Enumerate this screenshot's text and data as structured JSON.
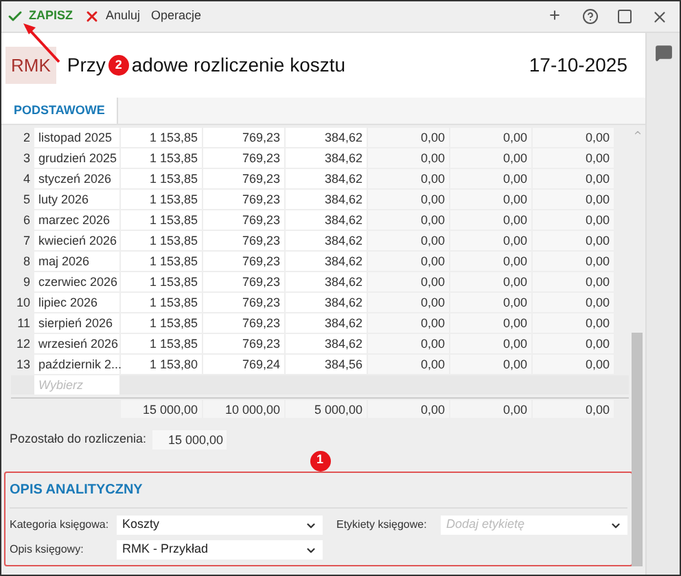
{
  "toolbar": {
    "buttons": [
      {
        "kind": "save",
        "label": "ZAPISZ"
      },
      {
        "kind": "cancel",
        "label": "Anuluj"
      },
      {
        "kind": "plain",
        "label": "Operacje"
      }
    ]
  },
  "header": {
    "badge": "RMK",
    "title_parts": [
      "Przy",
      "adowe rozliczenie kosztu"
    ],
    "marker": "2",
    "date": "17-10-2025"
  },
  "tabs": [
    {
      "label": "PODSTAWOWE",
      "selected": true
    }
  ],
  "table": {
    "rows": [
      {
        "number": "2",
        "month": "listopad 2025",
        "values": [
          "1 153,85",
          "769,23",
          "384,62",
          "0,00",
          "0,00",
          "0,00"
        ]
      },
      {
        "number": "3",
        "month": "grudzień 2025",
        "values": [
          "1 153,85",
          "769,23",
          "384,62",
          "0,00",
          "0,00",
          "0,00"
        ]
      },
      {
        "number": "4",
        "month": "styczeń 2026",
        "values": [
          "1 153,85",
          "769,23",
          "384,62",
          "0,00",
          "0,00",
          "0,00"
        ]
      },
      {
        "number": "5",
        "month": "luty 2026",
        "values": [
          "1 153,85",
          "769,23",
          "384,62",
          "0,00",
          "0,00",
          "0,00"
        ]
      },
      {
        "number": "6",
        "month": "marzec 2026",
        "values": [
          "1 153,85",
          "769,23",
          "384,62",
          "0,00",
          "0,00",
          "0,00"
        ]
      },
      {
        "number": "7",
        "month": "kwiecień 2026",
        "values": [
          "1 153,85",
          "769,23",
          "384,62",
          "0,00",
          "0,00",
          "0,00"
        ]
      },
      {
        "number": "8",
        "month": "maj 2026",
        "values": [
          "1 153,85",
          "769,23",
          "384,62",
          "0,00",
          "0,00",
          "0,00"
        ]
      },
      {
        "number": "9",
        "month": "czerwiec 2026",
        "values": [
          "1 153,85",
          "769,23",
          "384,62",
          "0,00",
          "0,00",
          "0,00"
        ]
      },
      {
        "number": "10",
        "month": "lipiec 2026",
        "values": [
          "1 153,85",
          "769,23",
          "384,62",
          "0,00",
          "0,00",
          "0,00"
        ]
      },
      {
        "number": "11",
        "month": "sierpień 2026",
        "values": [
          "1 153,85",
          "769,23",
          "384,62",
          "0,00",
          "0,00",
          "0,00"
        ]
      },
      {
        "number": "12",
        "month": "wrzesień 2026",
        "values": [
          "1 153,85",
          "769,23",
          "384,62",
          "0,00",
          "0,00",
          "0,00"
        ]
      },
      {
        "number": "13",
        "month": "październik 2...",
        "values": [
          "1 153,80",
          "769,24",
          "384,56",
          "0,00",
          "0,00",
          "0,00"
        ]
      }
    ],
    "new_row_placeholder": "Wybierz",
    "totals": [
      "15 000,00",
      "10 000,00",
      "5 000,00",
      "0,00",
      "0,00",
      "0,00"
    ]
  },
  "remaining": {
    "label": "Pozostało do rozliczenia:",
    "value": "15 000,00"
  },
  "marker": "1",
  "analytic_section": {
    "title": "OPIS ANALITYCZNY",
    "highlighted": true,
    "category": {
      "label": "Kategoria księgowa:",
      "value": "Koszty"
    },
    "description": {
      "label": "Opis księgowy:",
      "value": "RMK - Przykład"
    },
    "tags": {
      "label": "Etykiety księgowe:",
      "placeholder": "Dodaj etykietę"
    }
  }
}
